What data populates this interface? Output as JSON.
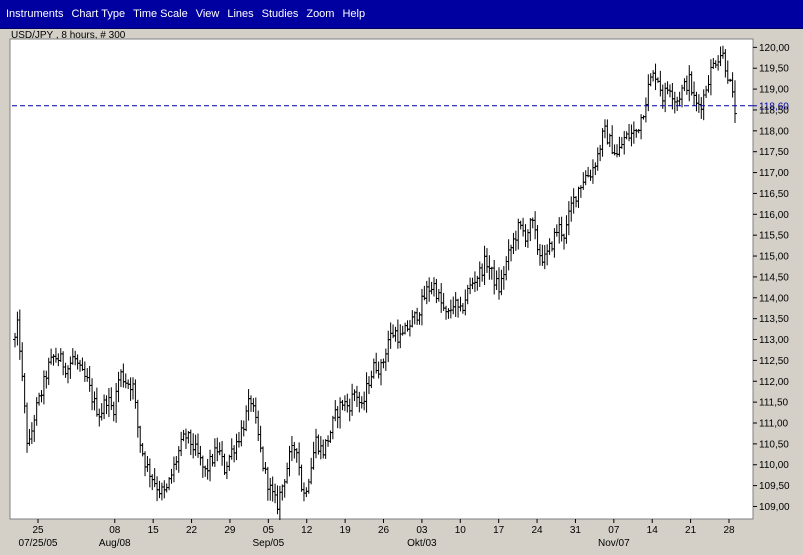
{
  "menubar": {
    "items": [
      {
        "label": "Instruments"
      },
      {
        "label": "Chart Type"
      },
      {
        "label": "Time Scale"
      },
      {
        "label": "View"
      },
      {
        "label": "Lines"
      },
      {
        "label": "Studies"
      },
      {
        "label": "Zoom"
      },
      {
        "label": "Help"
      }
    ]
  },
  "colors": {
    "menubar": "#0000a0",
    "chart_bg": "#ffffff",
    "frame_bg": "#d4d0c8",
    "bars": "#000000",
    "hline": "#0000a0"
  },
  "chart_data": {
    "type": "ohlc",
    "subtitle": "USD/JPY , 8 hours, # 300",
    "ylim": [
      108.7,
      120.2
    ],
    "y_ticks": [
      "109,00",
      "109,50",
      "110,00",
      "110,50",
      "111,00",
      "111,50",
      "112,00",
      "112,50",
      "113,00",
      "113,50",
      "114,00",
      "114,50",
      "115,00",
      "115,50",
      "116,00",
      "116,50",
      "117,00",
      "117,50",
      "118,00",
      "118,50",
      "119,00",
      "119,50",
      "120,00"
    ],
    "x_days": 118,
    "x_day_labels": [
      {
        "day": 0,
        "label": "25"
      },
      {
        "day": 14,
        "label": "08"
      },
      {
        "day": 21,
        "label": "15"
      },
      {
        "day": 28,
        "label": "22"
      },
      {
        "day": 35,
        "label": "29"
      },
      {
        "day": 42,
        "label": "05"
      },
      {
        "day": 49,
        "label": "12"
      },
      {
        "day": 56,
        "label": "19"
      },
      {
        "day": 63,
        "label": "26"
      },
      {
        "day": 70,
        "label": "03"
      },
      {
        "day": 77,
        "label": "10"
      },
      {
        "day": 84,
        "label": "17"
      },
      {
        "day": 91,
        "label": "24"
      },
      {
        "day": 98,
        "label": "31"
      },
      {
        "day": 105,
        "label": "07"
      },
      {
        "day": 112,
        "label": "14"
      },
      {
        "day": 119,
        "label": "21"
      },
      {
        "day": 126,
        "label": "28"
      }
    ],
    "x_month_labels": [
      {
        "day": 0,
        "label": "07/25/05"
      },
      {
        "day": 14,
        "label": "Aug/08"
      },
      {
        "day": 42,
        "label": "Sep/05"
      },
      {
        "day": 70,
        "label": "Okt/03"
      },
      {
        "day": 105,
        "label": "Nov/07"
      }
    ],
    "reference_line": {
      "value": 118.6,
      "label": "118,60"
    },
    "anchors": [
      [
        0,
        113.0
      ],
      [
        0.5,
        113.4
      ],
      [
        1,
        112.2
      ],
      [
        2,
        110.3
      ],
      [
        3,
        111.2
      ],
      [
        4,
        111.7
      ],
      [
        5,
        112.3
      ],
      [
        6,
        112.6
      ],
      [
        7,
        112.5
      ],
      [
        8,
        112.3
      ],
      [
        9,
        112.6
      ],
      [
        10,
        112.2
      ],
      [
        11,
        112.0
      ],
      [
        12,
        111.5
      ],
      [
        13,
        111.2
      ],
      [
        14,
        111.6
      ],
      [
        15,
        111.3
      ],
      [
        16,
        112.2
      ],
      [
        17,
        112.0
      ],
      [
        18,
        111.9
      ],
      [
        19,
        110.6
      ],
      [
        20,
        110.0
      ],
      [
        21,
        109.7
      ],
      [
        22,
        109.4
      ],
      [
        23,
        109.3
      ],
      [
        24,
        109.8
      ],
      [
        25,
        110.3
      ],
      [
        26,
        110.7
      ],
      [
        27,
        110.5
      ],
      [
        28,
        110.2
      ],
      [
        29,
        109.8
      ],
      [
        30,
        110.1
      ],
      [
        31,
        110.4
      ],
      [
        32,
        109.9
      ],
      [
        33,
        110.3
      ],
      [
        34,
        110.6
      ],
      [
        35,
        111.0
      ],
      [
        36,
        111.6
      ],
      [
        37,
        110.8
      ],
      [
        38,
        109.9
      ],
      [
        39,
        109.4
      ],
      [
        40,
        109.0
      ],
      [
        41,
        109.6
      ],
      [
        42,
        110.2
      ],
      [
        43,
        110.5
      ],
      [
        44,
        109.2
      ],
      [
        45,
        109.8
      ],
      [
        46,
        110.6
      ],
      [
        47,
        110.3
      ],
      [
        48,
        110.7
      ],
      [
        49,
        111.2
      ],
      [
        50,
        111.5
      ],
      [
        51,
        111.4
      ],
      [
        52,
        111.8
      ],
      [
        53,
        111.3
      ],
      [
        54,
        112.0
      ],
      [
        55,
        112.4
      ],
      [
        56,
        112.3
      ],
      [
        57,
        113.0
      ],
      [
        58,
        113.2
      ],
      [
        59,
        113.0
      ],
      [
        60,
        113.3
      ],
      [
        61,
        113.5
      ],
      [
        62,
        113.8
      ],
      [
        63,
        114.2
      ],
      [
        64,
        114.3
      ],
      [
        65,
        113.9
      ],
      [
        66,
        113.5
      ],
      [
        67,
        113.9
      ],
      [
        68,
        113.6
      ],
      [
        69,
        114.1
      ],
      [
        70,
        114.4
      ],
      [
        71,
        114.6
      ],
      [
        72,
        114.9
      ],
      [
        73,
        114.5
      ],
      [
        74,
        114.2
      ],
      [
        75,
        114.8
      ],
      [
        76,
        115.3
      ],
      [
        77,
        115.7
      ],
      [
        78,
        115.5
      ],
      [
        79,
        115.8
      ],
      [
        80,
        115.1
      ],
      [
        81,
        114.9
      ],
      [
        82,
        115.3
      ],
      [
        83,
        115.7
      ],
      [
        84,
        115.5
      ],
      [
        85,
        116.2
      ],
      [
        86,
        116.6
      ],
      [
        87,
        116.9
      ],
      [
        88,
        117.0
      ],
      [
        89,
        117.4
      ],
      [
        90,
        118.0
      ],
      [
        91,
        117.7
      ],
      [
        92,
        117.4
      ],
      [
        93,
        117.8
      ],
      [
        94,
        117.9
      ],
      [
        95,
        118.0
      ],
      [
        96,
        118.5
      ],
      [
        97,
        119.2
      ],
      [
        98,
        119.4
      ],
      [
        99,
        118.8
      ],
      [
        100,
        119.1
      ],
      [
        101,
        118.7
      ],
      [
        102,
        119.0
      ],
      [
        103,
        119.2
      ],
      [
        104,
        118.6
      ],
      [
        105,
        118.7
      ],
      [
        106,
        119.3
      ],
      [
        107,
        119.7
      ],
      [
        108,
        119.9
      ],
      [
        109,
        119.3
      ],
      [
        110,
        118.5
      ]
    ]
  }
}
